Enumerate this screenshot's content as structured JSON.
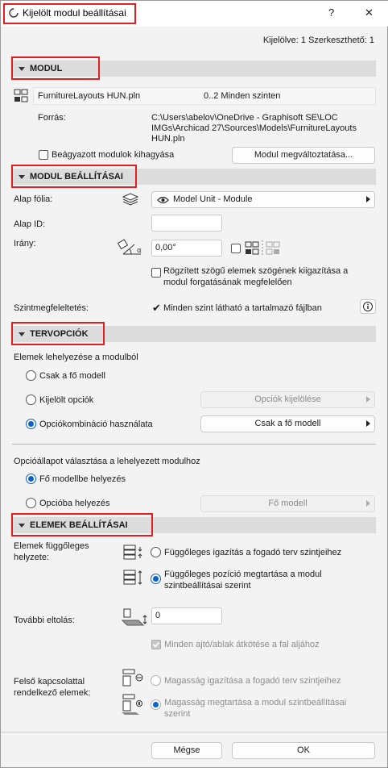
{
  "window": {
    "title": "Kijelölt modul beállításai",
    "help_label": "?",
    "close_label": "✕",
    "selection_info": "Kijelölve: 1 Szerkeszthető: 1"
  },
  "sections": {
    "modul": "MODUL",
    "modul_settings": "MODUL BEÁLLÍTÁSAI",
    "plan_options": "TERVOPCIÓK",
    "element_settings": "ELEMEK BEÁLLÍTÁSAI"
  },
  "modul": {
    "file_name": "FurnitureLayouts HUN.pln",
    "file_stories": "0..2 Minden szinten",
    "source_label": "Forrás:",
    "source_path": [
      "C:\\Users\\abelov\\OneDrive - Graphisoft SE\\LOC",
      "IMGs\\Archicad 27\\Sources\\Models\\FurnitureLayouts",
      "HUN.pln"
    ],
    "skip_nested_label": "Beágyazott modulok kihagyása",
    "change_module_button": "Modul megváltoztatása..."
  },
  "modul_settings": {
    "base_layer_label": "Alap fólia:",
    "base_layer_value": "Model Unit - Module",
    "base_id_label": "Alap ID:",
    "base_id_value": "",
    "orientation_label": "Irány:",
    "orientation_value": "0,00°",
    "fixed_angle_label": [
      "Rögzített szögű elemek szögének kiigazítása a",
      "modul forgatásának megfelelően"
    ],
    "story_matching_label": "Szintmegfeleltetés:",
    "story_matching_value": "Minden szint látható a tartalmazó fájlban"
  },
  "plan_options": {
    "placement_heading": "Elemek lehelyezése a modulból",
    "radio_main_only": "Csak a fő modell",
    "radio_selected_options": "Kijelölt opciók",
    "radio_option_combination": "Opciókombináció használata",
    "option_selection_button": "Opciók kijelölése",
    "combination_button": "Csak a fő modell",
    "state_heading": "Opcióállapot választása a lehelyezett modulhoz",
    "radio_main_model": "Fő modellbe helyezés",
    "radio_into_option": "Opcióba helyezés",
    "into_option_button": "Fő modell"
  },
  "element_settings": {
    "vertical_position_label": [
      "Elemek függőleges",
      "helyzete:"
    ],
    "radio_vertical_align": "Függőleges igazítás a fogadó terv szintjeihez",
    "radio_vertical_keep": [
      "Függőleges pozíció megtartása a modul",
      "szintbeállításai szerint"
    ],
    "offset_label": "További eltolás:",
    "offset_value": "0",
    "door_window_label": "Minden ajtó/ablak átkötése a fal aljához",
    "top_linked_label": [
      "Felső kapcsolattal",
      "rendelkező elemek:"
    ],
    "radio_height_adjust": "Magasság igazítása a fogadó terv szintjeihez",
    "radio_height_keep": [
      "Magasság megtartása a modul szintbeállításai",
      "szerint"
    ]
  },
  "footer": {
    "cancel_button": "Mégse",
    "ok_button": "OK"
  },
  "colors": {
    "accent": "#0a64c8",
    "highlight_box": "#e02020",
    "section_bar": "#dcdcdc"
  }
}
